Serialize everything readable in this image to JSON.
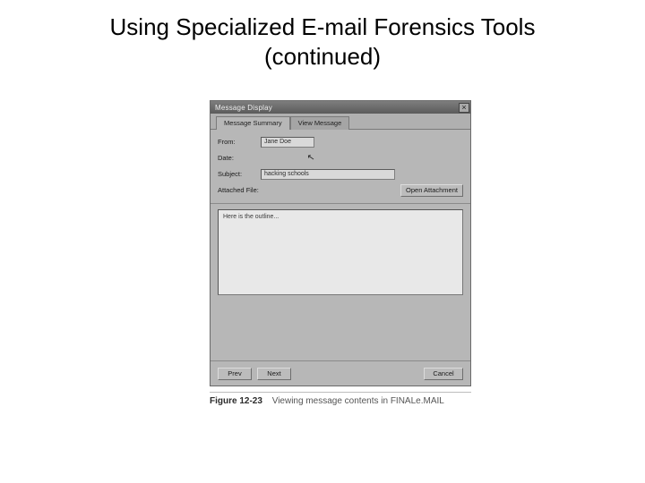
{
  "slide": {
    "title_line1": "Using Specialized E-mail Forensics Tools",
    "title_line2": "(continued)"
  },
  "window": {
    "title": "Message Display",
    "close_glyph": "×",
    "tabs": [
      {
        "label": "Message Summary",
        "active": true
      },
      {
        "label": "View Message",
        "active": false
      }
    ],
    "fields": {
      "from_label": "From:",
      "from_value": "Jane Doe",
      "date_label": "Date:",
      "date_value": "",
      "subject_label": "Subject:",
      "subject_value": "hacking schools",
      "attached_label": "Attached File:",
      "attached_value": ""
    },
    "buttons": {
      "open_attachment": "Open Attachment",
      "prev": "Prev",
      "next": "Next",
      "cancel": "Cancel"
    },
    "body_text": "Here is the outline..."
  },
  "figure": {
    "number": "Figure 12-23",
    "description": "Viewing message contents in FINALe.MAIL"
  }
}
